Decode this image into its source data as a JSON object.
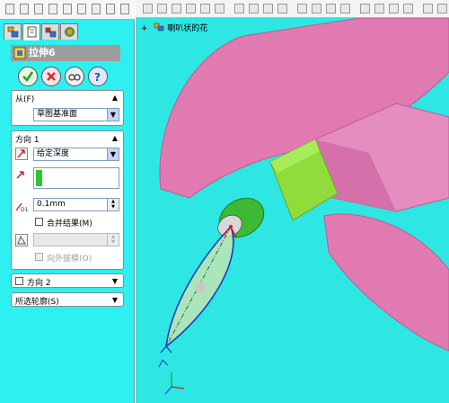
{
  "feature_manager": {
    "title": "拉伸6",
    "from": {
      "header": "从(F)",
      "value": "草图基准面"
    },
    "direction1": {
      "header": "方向 1",
      "end_condition": "给定深度",
      "depth": "0.1mm",
      "merge_label": "合并结果(M)",
      "draft_outward_label": "向外拔模(O)"
    },
    "direction2": {
      "header": "方向 2"
    },
    "selected_contours": {
      "header": "所选轮廓(S)"
    }
  },
  "viewport": {
    "tree_label": "喇叭状的花"
  },
  "colors": {
    "panel_bg": "#2ef0f0",
    "viewport_bg": "#2ee6e2",
    "petal_pink": "#e07ab0",
    "stem_green": "#7fd42a",
    "ok_green": "#2aa02a",
    "cancel_red": "#d03030"
  },
  "icons": {
    "ok": "checkmark-icon",
    "cancel": "x-icon",
    "preview": "glasses-icon",
    "help": "question-icon"
  }
}
